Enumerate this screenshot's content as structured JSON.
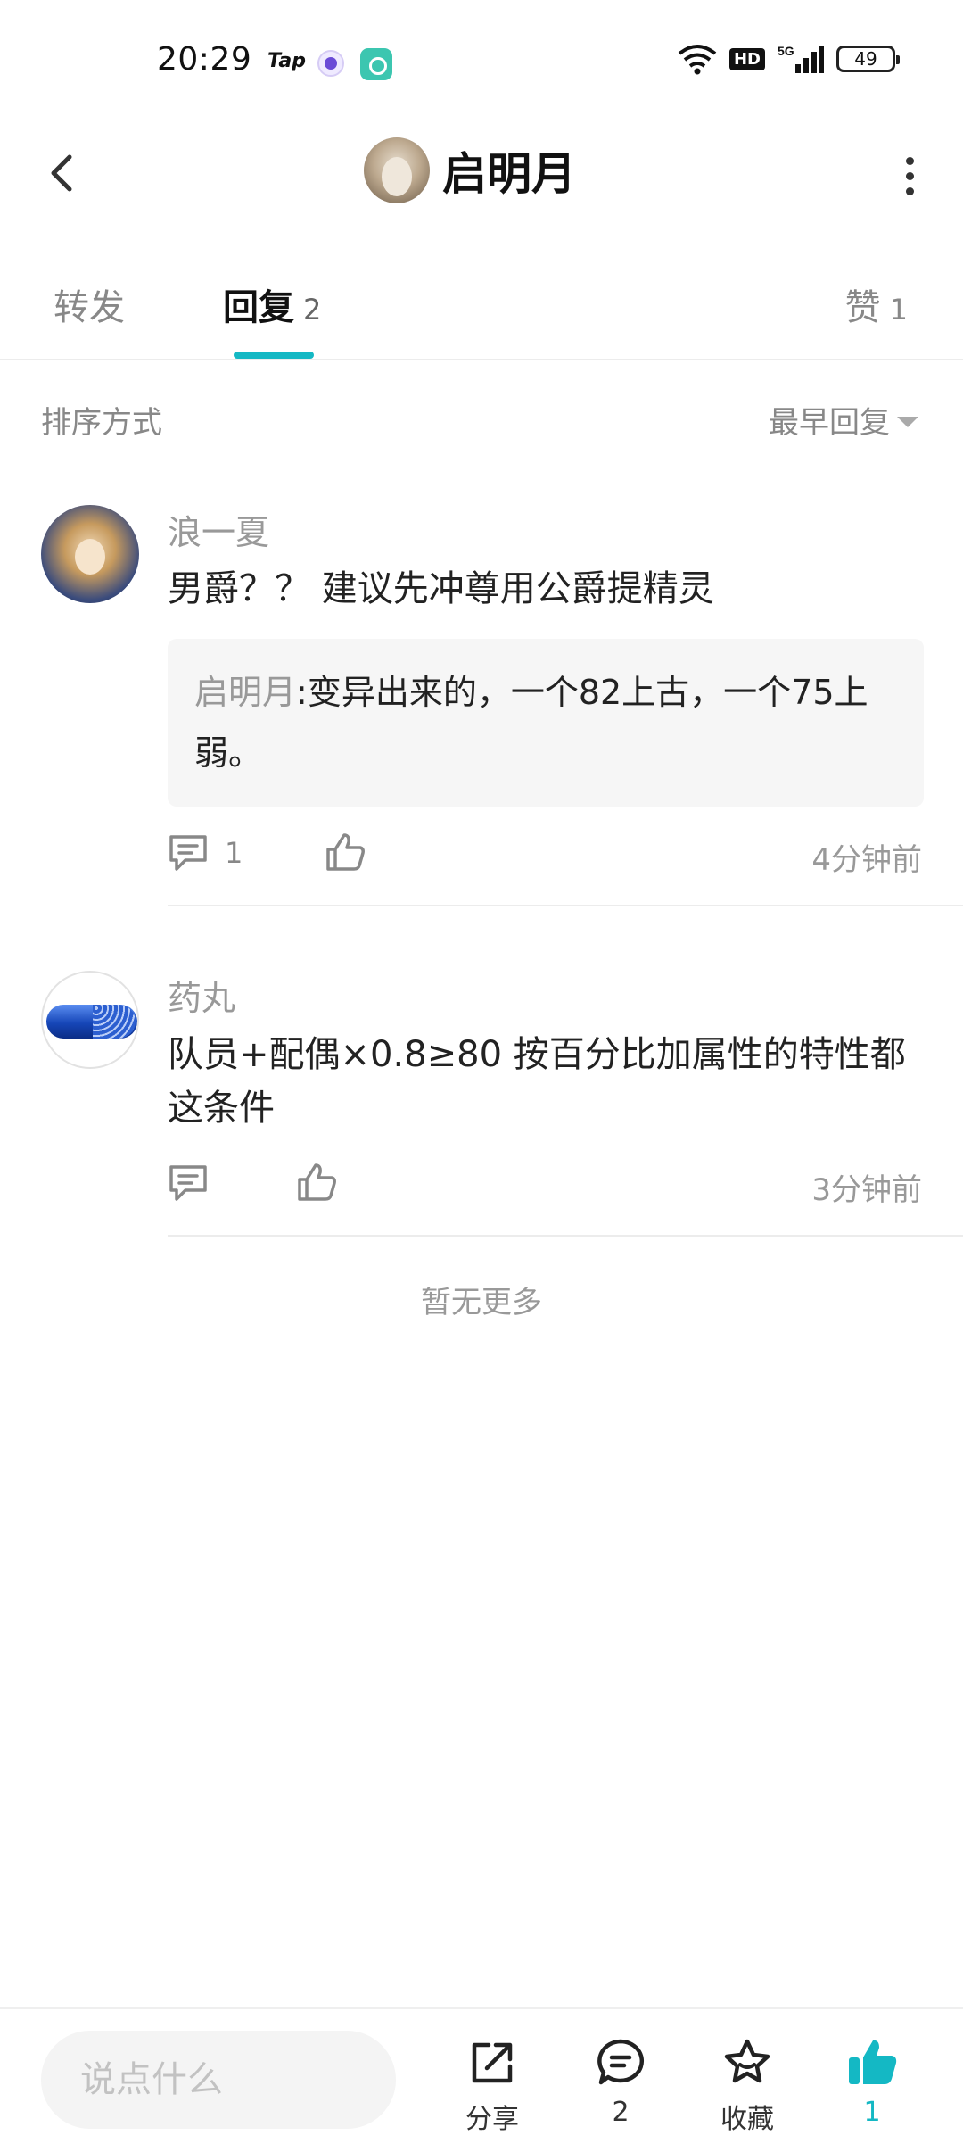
{
  "status_bar": {
    "time": "20:29",
    "tap_label": "Tap",
    "hd_label": "HD",
    "network_label": "5G",
    "battery": "49"
  },
  "header": {
    "title": "启明月"
  },
  "tabs": {
    "forward": "转发",
    "reply": "回复",
    "reply_count": "2",
    "like": "赞",
    "like_count": "1"
  },
  "sort": {
    "label": "排序方式",
    "value": "最早回复"
  },
  "replies": [
    {
      "author": "浪一夏",
      "text": "男爵？？ 建议先冲尊用公爵提精灵",
      "quote_author": "启明月",
      "quote_text": ":变异出来的，一个82上古，一个75上弱。",
      "comment_count": "1",
      "time": "4分钟前"
    },
    {
      "author": "药丸",
      "text": "队员+配偶×0.8≥80 按百分比加属性的特性都这条件",
      "time": "3分钟前"
    }
  ],
  "no_more": "暂无更多",
  "bottom_bar": {
    "input_placeholder": "说点什么",
    "share_label": "分享",
    "comment_count": "2",
    "favorite_label": "收藏",
    "like_count": "1",
    "accent_color": "#14b8c4"
  }
}
